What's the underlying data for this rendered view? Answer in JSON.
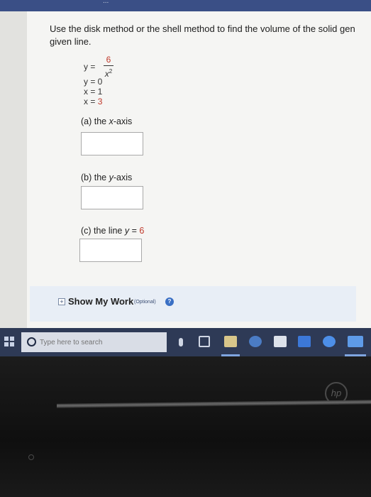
{
  "top_caption": "...",
  "problem": {
    "line1": "Use the disk method or the shell method to find the volume of the solid gen",
    "line2": "given line."
  },
  "equations": {
    "y_lhs": "y =",
    "frac_num": "6",
    "frac_den": "x",
    "frac_exp": "2",
    "eq2": "y = 0",
    "eq3": "x = 1",
    "eq4_prefix": "x = ",
    "eq4_value": "3"
  },
  "parts": [
    {
      "label": "(a) the ",
      "axis": "x",
      "suffix": "-axis",
      "answer": ""
    },
    {
      "label": "(b) the ",
      "axis": "y",
      "suffix": "-axis",
      "answer": ""
    },
    {
      "label": "(c) the line ",
      "var": "y",
      "equals": " = ",
      "value": "6",
      "answer": ""
    }
  ],
  "show_work": {
    "label": "Show My Work",
    "optional": "(Optional)",
    "help": "?"
  },
  "taskbar": {
    "search_placeholder": "Type here to search"
  },
  "brand": "hp",
  "colors": {
    "accent_red": "#c0392b",
    "taskbar": "#2e3a56",
    "help_blue": "#3a6fc4"
  }
}
